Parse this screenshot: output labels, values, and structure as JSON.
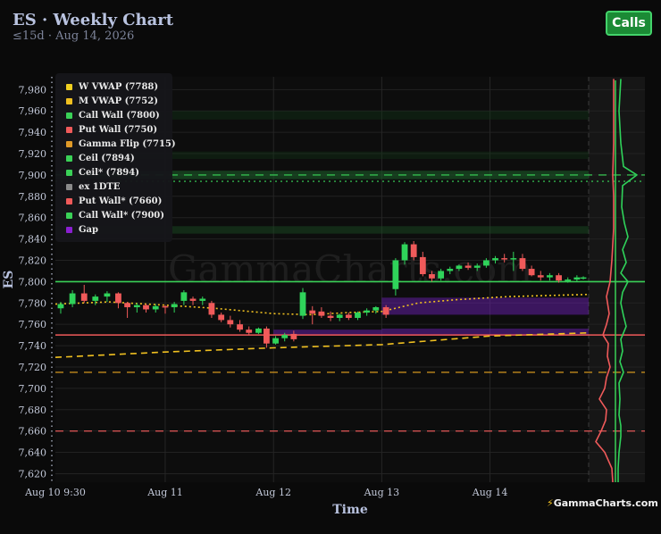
{
  "header": {
    "title": "ES · Weekly Chart",
    "subtitle": "≤15d · Aug 14, 2026",
    "calls_label": "Calls"
  },
  "watermark": "GammaCharts.com",
  "brand": "GammaCharts.com",
  "chart_data": {
    "type": "candlestick",
    "xlabel": "Time",
    "ylabel": "ES",
    "ylim": [
      7612,
      7992
    ],
    "x_range": [
      0,
      100
    ],
    "y_ticks": [
      "7,980",
      "7,960",
      "7,940",
      "7,920",
      "7,900",
      "7,880",
      "7,860",
      "7,840",
      "7,820",
      "7,800",
      "7,780",
      "7,760",
      "7,740",
      "7,720",
      "7,700",
      "7,680",
      "7,660",
      "7,640",
      "7,620"
    ],
    "y_tick_values": [
      7980,
      7960,
      7940,
      7920,
      7900,
      7880,
      7860,
      7840,
      7820,
      7800,
      7780,
      7760,
      7740,
      7720,
      7700,
      7680,
      7660,
      7640,
      7620
    ],
    "x_ticks": [
      {
        "label": "Aug 10 9:30",
        "x": 0
      },
      {
        "label": "Aug 11",
        "x": 20.6
      },
      {
        "label": "Aug 12",
        "x": 40.9
      },
      {
        "label": "Aug 13",
        "x": 61.2
      },
      {
        "label": "Aug 14",
        "x": 81.5
      }
    ],
    "levels": [
      {
        "name": "Call Wall",
        "value": 7800,
        "color": "#3ad157",
        "style": "solid"
      },
      {
        "name": "Put Wall",
        "value": 7750,
        "color": "#f05a5a",
        "style": "solid"
      },
      {
        "name": "Gamma Flip",
        "value": 7715,
        "color": "#e0a020",
        "style": "dashed"
      },
      {
        "name": "Ceil*",
        "value": 7894,
        "color": "#3ad157",
        "style": "dotted"
      },
      {
        "name": "Call Wall*",
        "value": 7900,
        "color": "#3ad157",
        "style": "dashed"
      },
      {
        "name": "Put Wall*",
        "value": 7660,
        "color": "#f05a5a",
        "style": "dashed"
      }
    ],
    "bands": [
      {
        "y0": 7896,
        "y1": 7904,
        "color": "#1a5a28",
        "opacity": 0.6
      },
      {
        "y0": 7845,
        "y1": 7852,
        "color": "#1a4a22",
        "opacity": 0.5
      },
      {
        "y0": 7952,
        "y1": 7960,
        "color": "#123818",
        "opacity": 0.4
      },
      {
        "y0": 7915,
        "y1": 7922,
        "color": "#123818",
        "opacity": 0.35
      }
    ],
    "gaps": [
      {
        "x0": 61.2,
        "x1": 100,
        "y0": 7769,
        "y1": 7785
      },
      {
        "x0": 40.9,
        "x1": 61.2,
        "y0": 7750,
        "y1": 7755
      },
      {
        "x0": 61.2,
        "x1": 100,
        "y0": 7750,
        "y1": 7756
      }
    ],
    "series": [
      {
        "name": "W VWAP",
        "color": "#f0c020",
        "style": "dotted",
        "x": [
          0,
          10,
          20.6,
          30,
          40.9,
          48,
          55,
          61.2,
          68,
          75,
          85,
          100
        ],
        "y": [
          7779,
          7781,
          7778,
          7775,
          7770,
          7769,
          7771,
          7772,
          7780,
          7783,
          7786,
          7788
        ]
      },
      {
        "name": "M VWAP",
        "color": "#f0c020",
        "style": "dashed",
        "x": [
          0,
          20.6,
          40.9,
          61.2,
          81.5,
          100
        ],
        "y": [
          7729,
          7734,
          7738,
          7741,
          7749,
          7752
        ]
      }
    ],
    "candles": [
      {
        "x": 1.0,
        "o": 7775,
        "h": 7781,
        "l": 7770,
        "c": 7779
      },
      {
        "x": 3.2,
        "o": 7779,
        "h": 7792,
        "l": 7776,
        "c": 7789
      },
      {
        "x": 5.4,
        "o": 7789,
        "h": 7797,
        "l": 7780,
        "c": 7782
      },
      {
        "x": 7.5,
        "o": 7782,
        "h": 7788,
        "l": 7778,
        "c": 7786
      },
      {
        "x": 9.7,
        "o": 7786,
        "h": 7791,
        "l": 7781,
        "c": 7789
      },
      {
        "x": 11.8,
        "o": 7789,
        "h": 7790,
        "l": 7775,
        "c": 7780
      },
      {
        "x": 13.5,
        "o": 7780,
        "h": 7781,
        "l": 7766,
        "c": 7776
      },
      {
        "x": 15.3,
        "o": 7776,
        "h": 7780,
        "l": 7771,
        "c": 7778
      },
      {
        "x": 17.0,
        "o": 7778,
        "h": 7779,
        "l": 7771,
        "c": 7774
      },
      {
        "x": 18.8,
        "o": 7774,
        "h": 7779,
        "l": 7771,
        "c": 7777
      },
      {
        "x": 20.6,
        "o": 7777,
        "h": 7778,
        "l": 7770,
        "c": 7776
      },
      {
        "x": 22.3,
        "o": 7776,
        "h": 7781,
        "l": 7771,
        "c": 7779
      },
      {
        "x": 24.1,
        "o": 7782,
        "h": 7792,
        "l": 7778,
        "c": 7790
      },
      {
        "x": 25.8,
        "o": 7784,
        "h": 7786,
        "l": 7778,
        "c": 7782
      },
      {
        "x": 27.6,
        "o": 7782,
        "h": 7786,
        "l": 7778,
        "c": 7784
      },
      {
        "x": 29.3,
        "o": 7780,
        "h": 7782,
        "l": 7766,
        "c": 7769
      },
      {
        "x": 31.1,
        "o": 7769,
        "h": 7771,
        "l": 7762,
        "c": 7764
      },
      {
        "x": 32.8,
        "o": 7764,
        "h": 7768,
        "l": 7757,
        "c": 7760
      },
      {
        "x": 34.6,
        "o": 7760,
        "h": 7764,
        "l": 7753,
        "c": 7755
      },
      {
        "x": 36.3,
        "o": 7755,
        "h": 7758,
        "l": 7750,
        "c": 7752
      },
      {
        "x": 38.1,
        "o": 7752,
        "h": 7757,
        "l": 7751,
        "c": 7756
      },
      {
        "x": 39.6,
        "o": 7756,
        "h": 7758,
        "l": 7738,
        "c": 7742
      },
      {
        "x": 41.3,
        "o": 7742,
        "h": 7749,
        "l": 7741,
        "c": 7747
      },
      {
        "x": 43.0,
        "o": 7747,
        "h": 7752,
        "l": 7744,
        "c": 7750
      },
      {
        "x": 44.7,
        "o": 7751,
        "h": 7754,
        "l": 7744,
        "c": 7746
      },
      {
        "x": 46.4,
        "o": 7768,
        "h": 7794,
        "l": 7765,
        "c": 7790
      },
      {
        "x": 48.2,
        "o": 7773,
        "h": 7777,
        "l": 7760,
        "c": 7770
      },
      {
        "x": 49.9,
        "o": 7772,
        "h": 7776,
        "l": 7766,
        "c": 7768
      },
      {
        "x": 51.6,
        "o": 7768,
        "h": 7772,
        "l": 7763,
        "c": 7766
      },
      {
        "x": 53.3,
        "o": 7766,
        "h": 7770,
        "l": 7763,
        "c": 7769
      },
      {
        "x": 55.0,
        "o": 7769,
        "h": 7771,
        "l": 7764,
        "c": 7766
      },
      {
        "x": 56.7,
        "o": 7766,
        "h": 7772,
        "l": 7764,
        "c": 7771
      },
      {
        "x": 58.4,
        "o": 7771,
        "h": 7775,
        "l": 7768,
        "c": 7773
      },
      {
        "x": 60.1,
        "o": 7773,
        "h": 7777,
        "l": 7770,
        "c": 7776
      },
      {
        "x": 62.0,
        "o": 7776,
        "h": 7778,
        "l": 7766,
        "c": 7769
      },
      {
        "x": 63.8,
        "o": 7793,
        "h": 7822,
        "l": 7787,
        "c": 7820
      },
      {
        "x": 65.5,
        "o": 7820,
        "h": 7837,
        "l": 7816,
        "c": 7835
      },
      {
        "x": 67.2,
        "o": 7835,
        "h": 7838,
        "l": 7820,
        "c": 7823
      },
      {
        "x": 68.9,
        "o": 7823,
        "h": 7828,
        "l": 7805,
        "c": 7807
      },
      {
        "x": 70.6,
        "o": 7807,
        "h": 7810,
        "l": 7800,
        "c": 7803
      },
      {
        "x": 72.3,
        "o": 7803,
        "h": 7812,
        "l": 7801,
        "c": 7810
      },
      {
        "x": 74.0,
        "o": 7810,
        "h": 7814,
        "l": 7807,
        "c": 7812
      },
      {
        "x": 75.7,
        "o": 7812,
        "h": 7816,
        "l": 7810,
        "c": 7815
      },
      {
        "x": 77.4,
        "o": 7815,
        "h": 7818,
        "l": 7811,
        "c": 7813
      },
      {
        "x": 79.1,
        "o": 7813,
        "h": 7817,
        "l": 7810,
        "c": 7815
      },
      {
        "x": 80.8,
        "o": 7815,
        "h": 7822,
        "l": 7813,
        "c": 7820
      },
      {
        "x": 82.5,
        "o": 7820,
        "h": 7824,
        "l": 7817,
        "c": 7822
      },
      {
        "x": 84.2,
        "o": 7822,
        "h": 7826,
        "l": 7818,
        "c": 7821
      },
      {
        "x": 85.9,
        "o": 7821,
        "h": 7828,
        "l": 7810,
        "c": 7822
      },
      {
        "x": 87.6,
        "o": 7822,
        "h": 7826,
        "l": 7810,
        "c": 7812
      },
      {
        "x": 89.3,
        "o": 7812,
        "h": 7815,
        "l": 7805,
        "c": 7806
      },
      {
        "x": 91.0,
        "o": 7806,
        "h": 7810,
        "l": 7801,
        "c": 7804
      },
      {
        "x": 92.7,
        "o": 7804,
        "h": 7808,
        "l": 7801,
        "c": 7806
      },
      {
        "x": 94.4,
        "o": 7806,
        "h": 7808,
        "l": 7799,
        "c": 7801
      },
      {
        "x": 96.1,
        "o": 7801,
        "h": 7804,
        "l": 7799,
        "c": 7802
      },
      {
        "x": 97.8,
        "o": 7802,
        "h": 7806,
        "l": 7800,
        "c": 7804
      },
      {
        "x": 99.0,
        "o": 7803,
        "h": 7805,
        "l": 7802,
        "c": 7804
      }
    ],
    "volume_profile": {
      "green": [
        [
          7990,
          6
        ],
        [
          7960,
          4
        ],
        [
          7930,
          6
        ],
        [
          7908,
          9
        ],
        [
          7900,
          24
        ],
        [
          7890,
          8
        ],
        [
          7870,
          7
        ],
        [
          7855,
          10
        ],
        [
          7842,
          14
        ],
        [
          7830,
          8
        ],
        [
          7818,
          12
        ],
        [
          7808,
          6
        ],
        [
          7800,
          14
        ],
        [
          7790,
          8
        ],
        [
          7780,
          6
        ],
        [
          7768,
          9
        ],
        [
          7758,
          12
        ],
        [
          7746,
          6
        ],
        [
          7735,
          8
        ],
        [
          7725,
          5
        ],
        [
          7715,
          9
        ],
        [
          7705,
          4
        ],
        [
          7690,
          5
        ],
        [
          7675,
          4
        ],
        [
          7665,
          6
        ],
        [
          7655,
          6
        ],
        [
          7640,
          4
        ],
        [
          7625,
          3
        ],
        [
          7612,
          3
        ]
      ],
      "red": [
        [
          7990,
          2
        ],
        [
          7960,
          2
        ],
        [
          7930,
          2
        ],
        [
          7900,
          3
        ],
        [
          7880,
          2
        ],
        [
          7850,
          2
        ],
        [
          7820,
          4
        ],
        [
          7800,
          6
        ],
        [
          7786,
          10
        ],
        [
          7770,
          7
        ],
        [
          7760,
          10
        ],
        [
          7750,
          14
        ],
        [
          7742,
          8
        ],
        [
          7730,
          9
        ],
        [
          7720,
          6
        ],
        [
          7710,
          10
        ],
        [
          7700,
          12
        ],
        [
          7690,
          18
        ],
        [
          7680,
          10
        ],
        [
          7670,
          11
        ],
        [
          7660,
          16
        ],
        [
          7650,
          22
        ],
        [
          7640,
          12
        ],
        [
          7625,
          4
        ],
        [
          7612,
          3
        ]
      ]
    },
    "legend": [
      {
        "label": "W VWAP (7788)",
        "color": "#f0d020"
      },
      {
        "label": "M VWAP (7752)",
        "color": "#f0c020"
      },
      {
        "label": "Call Wall (7800)",
        "color": "#3ad157"
      },
      {
        "label": "Put Wall (7750)",
        "color": "#f05a5a"
      },
      {
        "label": "Gamma Flip (7715)",
        "color": "#e09a28"
      },
      {
        "label": "Ceil (7894)",
        "color": "#3ad157"
      },
      {
        "label": "Ceil* (7894)",
        "color": "#3ad157"
      },
      {
        "label": "ex 1DTE",
        "color": "#8a8a8a"
      },
      {
        "label": "Put Wall* (7660)",
        "color": "#f05a5a"
      },
      {
        "label": "Call Wall* (7900)",
        "color": "#3ad157"
      },
      {
        "label": "Gap",
        "color": "#8a1fd0"
      }
    ]
  }
}
